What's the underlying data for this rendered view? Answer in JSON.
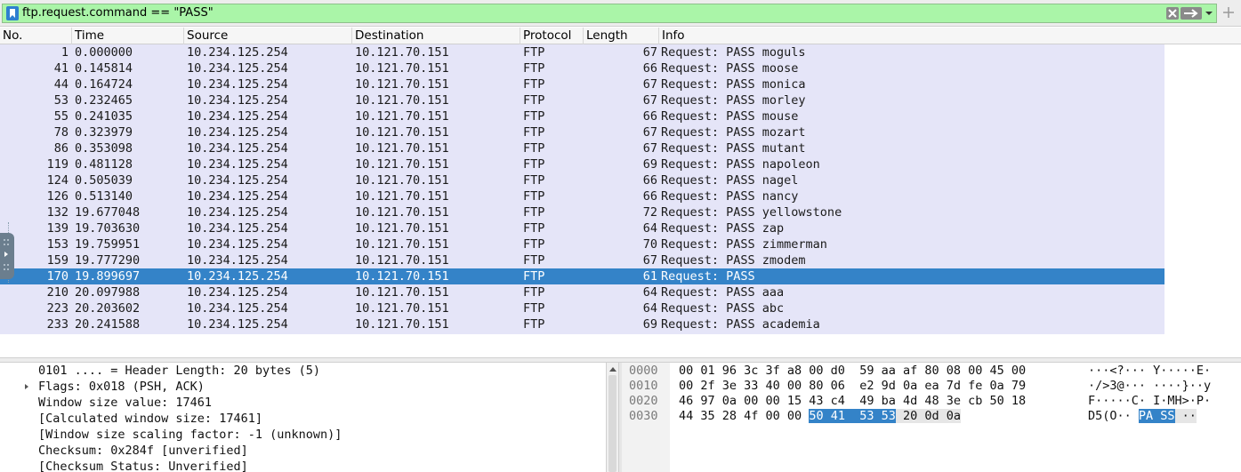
{
  "filter": {
    "expression": "ftp.request.command == \"PASS\"",
    "bookmark_icon": "bookmark-icon",
    "clear_icon": "clear-x-icon",
    "apply_icon": "arrow-right-icon",
    "dropdown_icon": "chevron-down-icon",
    "add_icon": "plus-icon",
    "bg_color": "#aaf5a8"
  },
  "packet_list": {
    "columns": [
      "No.",
      "Time",
      "Source",
      "Destination",
      "Protocol",
      "Length",
      "Info"
    ],
    "row_color": "#e5e5f8",
    "selected_color": "#3483c8",
    "rows": [
      {
        "no": "1",
        "time": "0.000000",
        "src": "10.234.125.254",
        "dst": "10.121.70.151",
        "proto": "FTP",
        "len": "67",
        "info": "Request: PASS moguls",
        "selected": false
      },
      {
        "no": "41",
        "time": "0.145814",
        "src": "10.234.125.254",
        "dst": "10.121.70.151",
        "proto": "FTP",
        "len": "66",
        "info": "Request: PASS moose",
        "selected": false
      },
      {
        "no": "44",
        "time": "0.164724",
        "src": "10.234.125.254",
        "dst": "10.121.70.151",
        "proto": "FTP",
        "len": "67",
        "info": "Request: PASS monica",
        "selected": false
      },
      {
        "no": "53",
        "time": "0.232465",
        "src": "10.234.125.254",
        "dst": "10.121.70.151",
        "proto": "FTP",
        "len": "67",
        "info": "Request: PASS morley",
        "selected": false
      },
      {
        "no": "55",
        "time": "0.241035",
        "src": "10.234.125.254",
        "dst": "10.121.70.151",
        "proto": "FTP",
        "len": "66",
        "info": "Request: PASS mouse",
        "selected": false
      },
      {
        "no": "78",
        "time": "0.323979",
        "src": "10.234.125.254",
        "dst": "10.121.70.151",
        "proto": "FTP",
        "len": "67",
        "info": "Request: PASS mozart",
        "selected": false
      },
      {
        "no": "86",
        "time": "0.353098",
        "src": "10.234.125.254",
        "dst": "10.121.70.151",
        "proto": "FTP",
        "len": "67",
        "info": "Request: PASS mutant",
        "selected": false
      },
      {
        "no": "119",
        "time": "0.481128",
        "src": "10.234.125.254",
        "dst": "10.121.70.151",
        "proto": "FTP",
        "len": "69",
        "info": "Request: PASS napoleon",
        "selected": false
      },
      {
        "no": "124",
        "time": "0.505039",
        "src": "10.234.125.254",
        "dst": "10.121.70.151",
        "proto": "FTP",
        "len": "66",
        "info": "Request: PASS nagel",
        "selected": false
      },
      {
        "no": "126",
        "time": "0.513140",
        "src": "10.234.125.254",
        "dst": "10.121.70.151",
        "proto": "FTP",
        "len": "66",
        "info": "Request: PASS nancy",
        "selected": false
      },
      {
        "no": "132",
        "time": "19.677048",
        "src": "10.234.125.254",
        "dst": "10.121.70.151",
        "proto": "FTP",
        "len": "72",
        "info": "Request: PASS yellowstone",
        "selected": false
      },
      {
        "no": "139",
        "time": "19.703630",
        "src": "10.234.125.254",
        "dst": "10.121.70.151",
        "proto": "FTP",
        "len": "64",
        "info": "Request: PASS zap",
        "selected": false
      },
      {
        "no": "153",
        "time": "19.759951",
        "src": "10.234.125.254",
        "dst": "10.121.70.151",
        "proto": "FTP",
        "len": "70",
        "info": "Request: PASS zimmerman",
        "selected": false
      },
      {
        "no": "159",
        "time": "19.777290",
        "src": "10.234.125.254",
        "dst": "10.121.70.151",
        "proto": "FTP",
        "len": "67",
        "info": "Request: PASS zmodem",
        "selected": false
      },
      {
        "no": "170",
        "time": "19.899697",
        "src": "10.234.125.254",
        "dst": "10.121.70.151",
        "proto": "FTP",
        "len": "61",
        "info": "Request: PASS",
        "selected": true
      },
      {
        "no": "210",
        "time": "20.097988",
        "src": "10.234.125.254",
        "dst": "10.121.70.151",
        "proto": "FTP",
        "len": "64",
        "info": "Request: PASS aaa",
        "selected": false
      },
      {
        "no": "223",
        "time": "20.203602",
        "src": "10.234.125.254",
        "dst": "10.121.70.151",
        "proto": "FTP",
        "len": "64",
        "info": "Request: PASS abc",
        "selected": false
      },
      {
        "no": "233",
        "time": "20.241588",
        "src": "10.234.125.254",
        "dst": "10.121.70.151",
        "proto": "FTP",
        "len": "69",
        "info": "Request: PASS academia",
        "selected": false
      }
    ]
  },
  "details": {
    "lines": [
      {
        "text": "0101 .... = Header Length: 20 bytes (5)",
        "expandable": false
      },
      {
        "text": "Flags: 0x018 (PSH, ACK)",
        "expandable": true
      },
      {
        "text": "Window size value: 17461",
        "expandable": false
      },
      {
        "text": "[Calculated window size: 17461]",
        "expandable": false
      },
      {
        "text": "[Window size scaling factor: -1 (unknown)]",
        "expandable": false
      },
      {
        "text": "Checksum: 0x284f [unverified]",
        "expandable": false
      },
      {
        "text": "[Checksum Status: Unverified]",
        "expandable": false
      }
    ]
  },
  "bytes": {
    "rows": [
      {
        "offset": "0000",
        "hex_pre": "00 01 96 3c 3f a8 00 d0  59 aa af 80 08 00 45 00",
        "hex_hl": "",
        "hex_hl2": "",
        "ascii_pre": "···<?··· Y·····E·",
        "ascii_hl": "",
        "ascii_hl2": ""
      },
      {
        "offset": "0010",
        "hex_pre": "00 2f 3e 33 40 00 80 06  e2 9d 0a ea 7d fe 0a 79",
        "hex_hl": "",
        "hex_hl2": "",
        "ascii_pre": "·/>3@··· ····}··y",
        "ascii_hl": "",
        "ascii_hl2": ""
      },
      {
        "offset": "0020",
        "hex_pre": "46 97 0a 00 00 15 43 c4  49 ba 4d 48 3e cb 50 18",
        "hex_hl": "",
        "hex_hl2": "",
        "ascii_pre": "F·····C· I·MH>·P·",
        "ascii_hl": "",
        "ascii_hl2": ""
      },
      {
        "offset": "0030",
        "hex_pre": "44 35 28 4f 00 00 ",
        "hex_hl": "50 41  53 53",
        "hex_hl2": " 20 0d 0a",
        "ascii_pre": "D5(O·· ",
        "ascii_hl": "PA SS",
        "ascii_hl2": " ··"
      }
    ]
  }
}
